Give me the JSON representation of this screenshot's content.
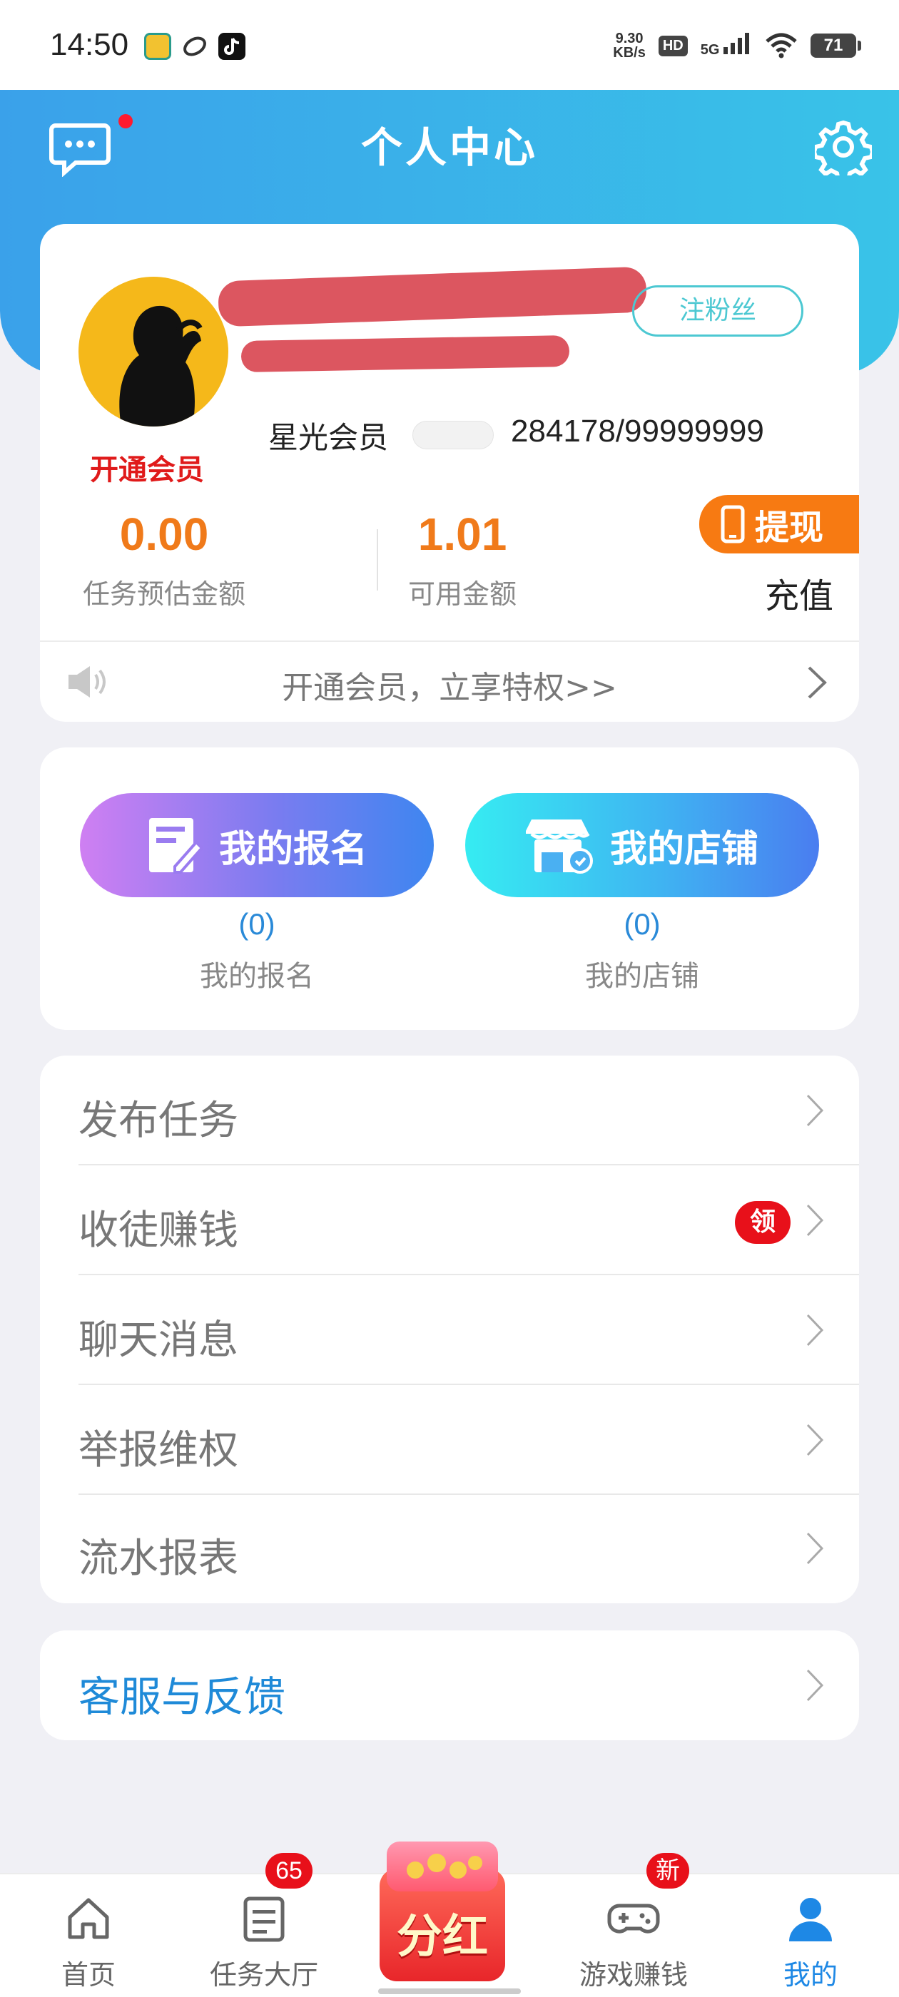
{
  "status_bar": {
    "time": "14:50",
    "net_speed_value": "9.30",
    "net_speed_unit": "KB/s",
    "hd": "HD",
    "signal": "5G",
    "battery": "71"
  },
  "header": {
    "title": "个人中心",
    "message_icon": "chat-bubble-icon",
    "settings_icon": "gear-icon",
    "colors": {
      "gradient_start": "#3aa1ea",
      "gradient_end": "#39c3e8"
    }
  },
  "profile": {
    "fans_button": "注粉丝",
    "open_vip": "开通会员",
    "member_level": "星光会员",
    "member_id": "284178/99999999",
    "estimated_amount": "0.00",
    "estimated_label": "任务预估金额",
    "available_amount": "1.01",
    "available_label": "可用金额",
    "withdraw": "提现",
    "recharge": "充值",
    "notice": "开通会员，立享特权>>"
  },
  "actions": {
    "signup": {
      "label": "我的报名",
      "count": "(0)",
      "caption": "我的报名"
    },
    "shop": {
      "label": "我的店铺",
      "count": "(0)",
      "caption": "我的店铺"
    }
  },
  "menu": [
    {
      "label": "发布任务"
    },
    {
      "label": "收徒赚钱",
      "badge": "领"
    },
    {
      "label": "聊天消息"
    },
    {
      "label": "举报维权"
    },
    {
      "label": "流水报表"
    }
  ],
  "service": {
    "label": "客服与反馈"
  },
  "tab_bar": {
    "home": "首页",
    "tasks": "任务大厅",
    "tasks_badge": "65",
    "fenhong": "分红",
    "games": "游戏赚钱",
    "games_badge": "新",
    "mine": "我的",
    "active_color": "#1e88e5"
  }
}
